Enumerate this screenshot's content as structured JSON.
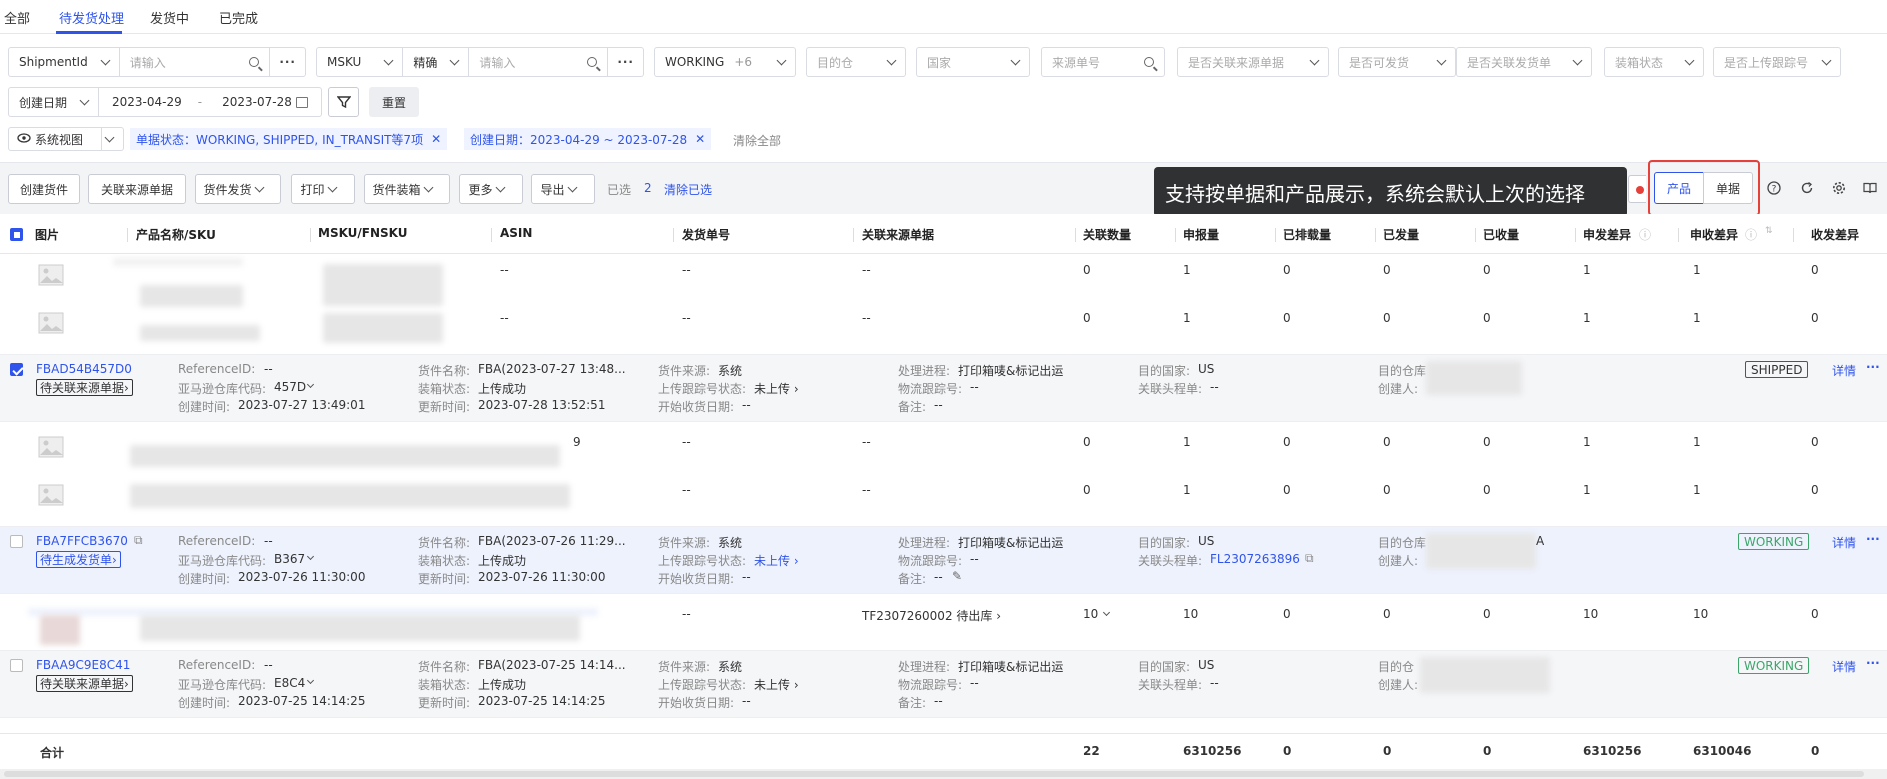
{
  "tabs": [
    "全部",
    "待发货处理",
    "发货中",
    "已完成"
  ],
  "filters": {
    "shipment_field": "ShipmentId",
    "input_placeholder": "请输入",
    "msku_field": "MSKU",
    "match_mode": "精确",
    "status_value": "WORKING",
    "status_extra": "+6",
    "dest_warehouse": "目的仓",
    "country": "国家",
    "source_no": "来源单号",
    "related_source": "是否关联来源单据",
    "can_ship": "是否可发货",
    "related_ship_order": "是否关联发货单",
    "packing_status": "装箱状态",
    "upload_tracking": "是否上传跟踪号",
    "date_type": "创建日期",
    "date_start": "2023-04-29",
    "date_sep": "-",
    "date_end": "2023-07-28",
    "reset": "重置"
  },
  "view": {
    "label": "系统视图",
    "chip1": "单据状态：WORKING, SHIPPED, IN_TRANSIT等7项",
    "chip2": "创建日期：2023-04-29 ~ 2023-07-28",
    "clear_all": "清除全部"
  },
  "toolbar": {
    "create": "创建货件",
    "link_source": "关联来源单据",
    "ship": "货件发货",
    "print": "打印",
    "pack": "货件装箱",
    "more": "更多",
    "export": "导出",
    "selected_label": "已选",
    "selected_count": "2",
    "clear_selected": "清除已选",
    "view_product": "产品",
    "view_document": "单据"
  },
  "tooltip": "支持按单据和产品展示，系统会默认上次的选择",
  "columns": [
    "图片",
    "产品名称/SKU",
    "MSKU/FNSKU",
    "ASIN",
    "发货单号",
    "关联来源单据",
    "关联数量",
    "申报量",
    "已排载量",
    "已发量",
    "已收量",
    "申发差异",
    "申收差异",
    "收发差异"
  ],
  "product_rows": [
    {
      "ship_no": "--",
      "src": "--",
      "asin": "--",
      "link_qty": "0",
      "declared": "1",
      "loaded": "0",
      "shipped": "0",
      "received": "0",
      "diff1": "1",
      "diff2": "1",
      "diff3": "0"
    },
    {
      "ship_no": "--",
      "src": "--",
      "asin": "--",
      "link_qty": "0",
      "declared": "1",
      "loaded": "0",
      "shipped": "0",
      "received": "0",
      "diff1": "1",
      "diff2": "1",
      "diff3": "0"
    },
    {
      "ship_no": "--",
      "src": "--",
      "asin": "9",
      "link_qty": "0",
      "declared": "1",
      "loaded": "0",
      "shipped": "0",
      "received": "0",
      "diff1": "1",
      "diff2": "1",
      "diff3": "0"
    },
    {
      "ship_no": "--",
      "src": "--",
      "asin": "",
      "link_qty": "0",
      "declared": "1",
      "loaded": "0",
      "shipped": "0",
      "received": "0",
      "diff1": "1",
      "diff2": "1",
      "diff3": "0"
    },
    {
      "ship_no": "--",
      "src": "TF2307260002 待出库",
      "asin": "",
      "link_qty": "10",
      "declared": "10",
      "loaded": "0",
      "shipped": "0",
      "received": "0",
      "diff1": "10",
      "diff2": "10",
      "diff3": "0"
    }
  ],
  "shipments": [
    {
      "id": "FBAD54B457D0",
      "action": "待关联来源单据",
      "ref_label": "ReferenceID:",
      "ref_value": "--",
      "wh_label": "亚马逊仓库代码:",
      "wh_value": "457D",
      "created_label": "创建时间:",
      "created_value": "2023-07-27 13:49:01",
      "name_label": "货件名称:",
      "name_value": "FBA(2023-07-27 13:48...",
      "pack_label": "装箱状态:",
      "pack_value": "上传成功",
      "upd_label": "更新时间:",
      "upd_value": "2023-07-28 13:52:51",
      "src_label": "货件来源:",
      "src_value": "系统",
      "trk_label": "上传跟踪号状态:",
      "trk_value": "未上传",
      "recv_label": "开始收货日期:",
      "recv_value": "--",
      "proc_label": "处理进程:",
      "proc_value": "打印箱唛&标记出运",
      "logi_label": "物流跟踪号:",
      "logi_value": "--",
      "note_label": "备注:",
      "note_value": "--",
      "country_label": "目的国家:",
      "country_value": "US",
      "head_label": "关联头程单:",
      "head_value": "--",
      "dest_label": "目的仓库",
      "dest_value": "",
      "creator_label": "创建人:",
      "creator_value": "",
      "status": "SHIPPED",
      "detail": "详情"
    },
    {
      "id": "FBA7FFCB3670",
      "action": "待生成发货单",
      "ref_label": "ReferenceID:",
      "ref_value": "--",
      "wh_label": "亚马逊仓库代码:",
      "wh_value": "B367",
      "created_label": "创建时间:",
      "created_value": "2023-07-26 11:30:00",
      "name_label": "货件名称:",
      "name_value": "FBA(2023-07-26 11:29...",
      "pack_label": "装箱状态:",
      "pack_value": "上传成功",
      "upd_label": "更新时间:",
      "upd_value": "2023-07-26 11:30:00",
      "src_label": "货件来源:",
      "src_value": "系统",
      "trk_label": "上传跟踪号状态:",
      "trk_value": "未上传",
      "recv_label": "开始收货日期:",
      "recv_value": "--",
      "proc_label": "处理进程:",
      "proc_value": "打印箱唛&标记出运",
      "logi_label": "物流跟踪号:",
      "logi_value": "--",
      "note_label": "备注:",
      "note_value": "--",
      "country_label": "目的国家:",
      "country_value": "US",
      "head_label": "关联头程单:",
      "head_value": "FL2307263896",
      "dest_label": "目的仓库",
      "dest_value": "A",
      "creator_label": "创建人:",
      "creator_value": "",
      "status": "WORKING",
      "detail": "详情"
    },
    {
      "id": "FBAA9C9E8C41",
      "action": "待关联来源单据",
      "ref_label": "ReferenceID:",
      "ref_value": "--",
      "wh_label": "亚马逊仓库代码:",
      "wh_value": "E8C4",
      "created_label": "创建时间:",
      "created_value": "2023-07-25 14:14:25",
      "name_label": "货件名称:",
      "name_value": "FBA(2023-07-25 14:14...",
      "pack_label": "装箱状态:",
      "pack_value": "上传成功",
      "upd_label": "更新时间:",
      "upd_value": "2023-07-25 14:14:25",
      "src_label": "货件来源:",
      "src_value": "系统",
      "trk_label": "上传跟踪号状态:",
      "trk_value": "未上传",
      "recv_label": "开始收货日期:",
      "recv_value": "--",
      "proc_label": "处理进程:",
      "proc_value": "打印箱唛&标记出运",
      "logi_label": "物流跟踪号:",
      "logi_value": "--",
      "note_label": "备注:",
      "note_value": "--",
      "country_label": "目的国家:",
      "country_value": "US",
      "head_label": "关联头程单:",
      "head_value": "--",
      "dest_label": "目的仓",
      "dest_value": "",
      "creator_label": "创建人:",
      "creator_value": "",
      "status": "WORKING",
      "detail": "详情"
    }
  ],
  "totals": {
    "label": "合计",
    "link_qty": "22",
    "declared": "6310256",
    "loaded": "0",
    "shipped": "0",
    "received": "0",
    "diff1": "6310256",
    "diff2": "6310046",
    "diff3": "0"
  },
  "colors": {
    "accent": "#2f54eb",
    "working": "#3ca66a",
    "highlight_red": "#e5413a",
    "tooltip_bg": "#303133"
  }
}
